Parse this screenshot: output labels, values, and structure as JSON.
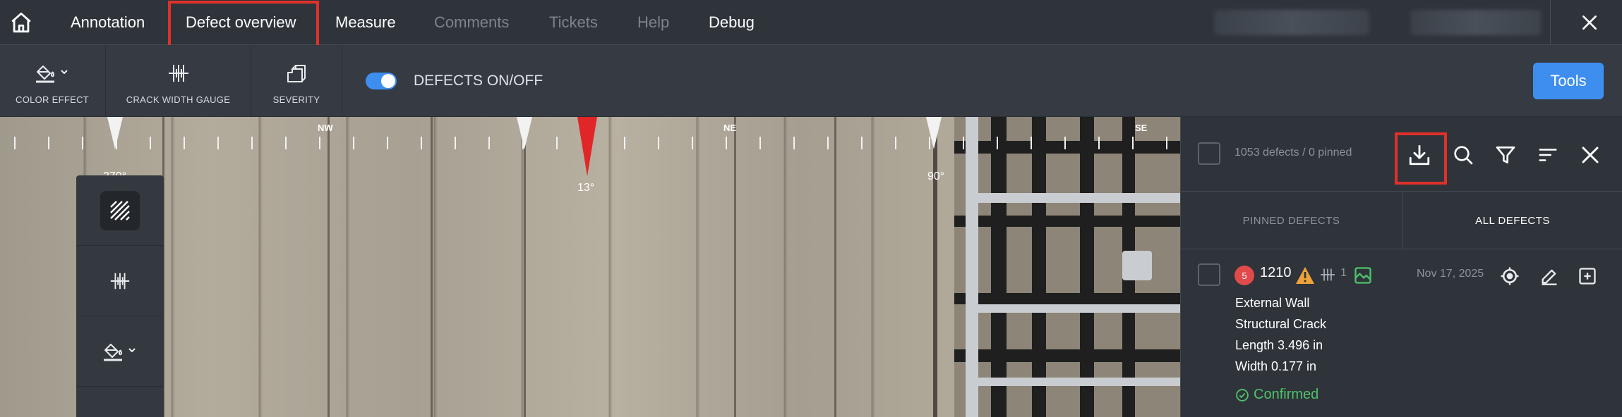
{
  "nav": {
    "tabs": [
      {
        "label": "Annotation"
      },
      {
        "label": "Defect overview"
      },
      {
        "label": "Measure"
      },
      {
        "label": "Comments"
      },
      {
        "label": "Tickets"
      },
      {
        "label": "Help"
      },
      {
        "label": "Debug"
      }
    ]
  },
  "toolbar": {
    "color_effect": "COLOR EFFECT",
    "crack_width_gauge": "CRACK WIDTH GAUGE",
    "severity": "SEVERITY",
    "defects_toggle": "DEFECTS ON/OFF",
    "defects_toggle_on": true,
    "tools_button": "Tools"
  },
  "compass": {
    "labels": {
      "nw": "NW",
      "ne": "NE",
      "se": "SE"
    },
    "heading": "13°",
    "mark_90": "90°",
    "mark_270": "270°"
  },
  "panel": {
    "count": "1053 defects / 0 pinned",
    "tabs": {
      "pinned": "PINNED DEFECTS",
      "all": "ALL DEFECTS"
    },
    "active_tab": "all"
  },
  "defect": {
    "severity": "5",
    "id": "1210",
    "width_count": "1",
    "date": "Nov 17, 2025",
    "location": "External Wall",
    "type": "Structural Crack",
    "length": "Length 3.496 in",
    "width": "Width 0.177 in",
    "status": "Confirmed"
  },
  "colors": {
    "accent": "#3e8ef0",
    "highlight": "#e0302a",
    "severity": "#e04a4a",
    "confirmed": "#4ec26a",
    "warning": "#f0a23a"
  }
}
